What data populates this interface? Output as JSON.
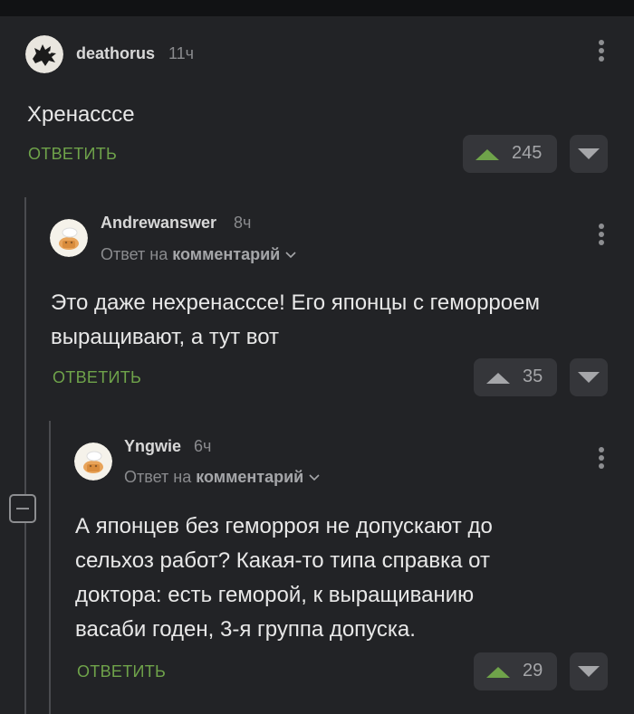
{
  "comments": [
    {
      "author": "deathorus",
      "time": "11ч",
      "text": "Хренасссе",
      "reply_label": "ОТВЕТИТЬ",
      "votes": "245"
    },
    {
      "author": "Andrewanswer",
      "time": "8ч",
      "reply_to_prefix": "Ответ на",
      "reply_to_link": "комментарий",
      "text_lines": [
        "Это даже нехренасссе! Его японцы с геморроем",
        "выращивают, а тут вот"
      ],
      "reply_label": "ОТВЕТИТЬ",
      "votes": "35"
    },
    {
      "author": "Yngwie",
      "time": "6ч",
      "reply_to_prefix": "Ответ на",
      "reply_to_link": "комментарий",
      "text_lines": [
        "А японцев без геморроя не допускают до",
        "сельхоз работ? Какая-то типа справка от",
        "доктора: есть геморой, к выращиванию",
        "васаби годен, 3-я группа допуска."
      ],
      "reply_label": "ОТВЕТИТЬ",
      "votes": "29"
    }
  ],
  "colors": {
    "background": "#222326",
    "accent_green": "#6fa34a",
    "vote_bg": "#35363a"
  },
  "icons": [
    "avatar-crow",
    "avatar-chef",
    "kebab-menu-icon",
    "upvote-arrow-icon",
    "downvote-arrow-icon",
    "chevron-down-icon",
    "collapse-thread-icon"
  ]
}
